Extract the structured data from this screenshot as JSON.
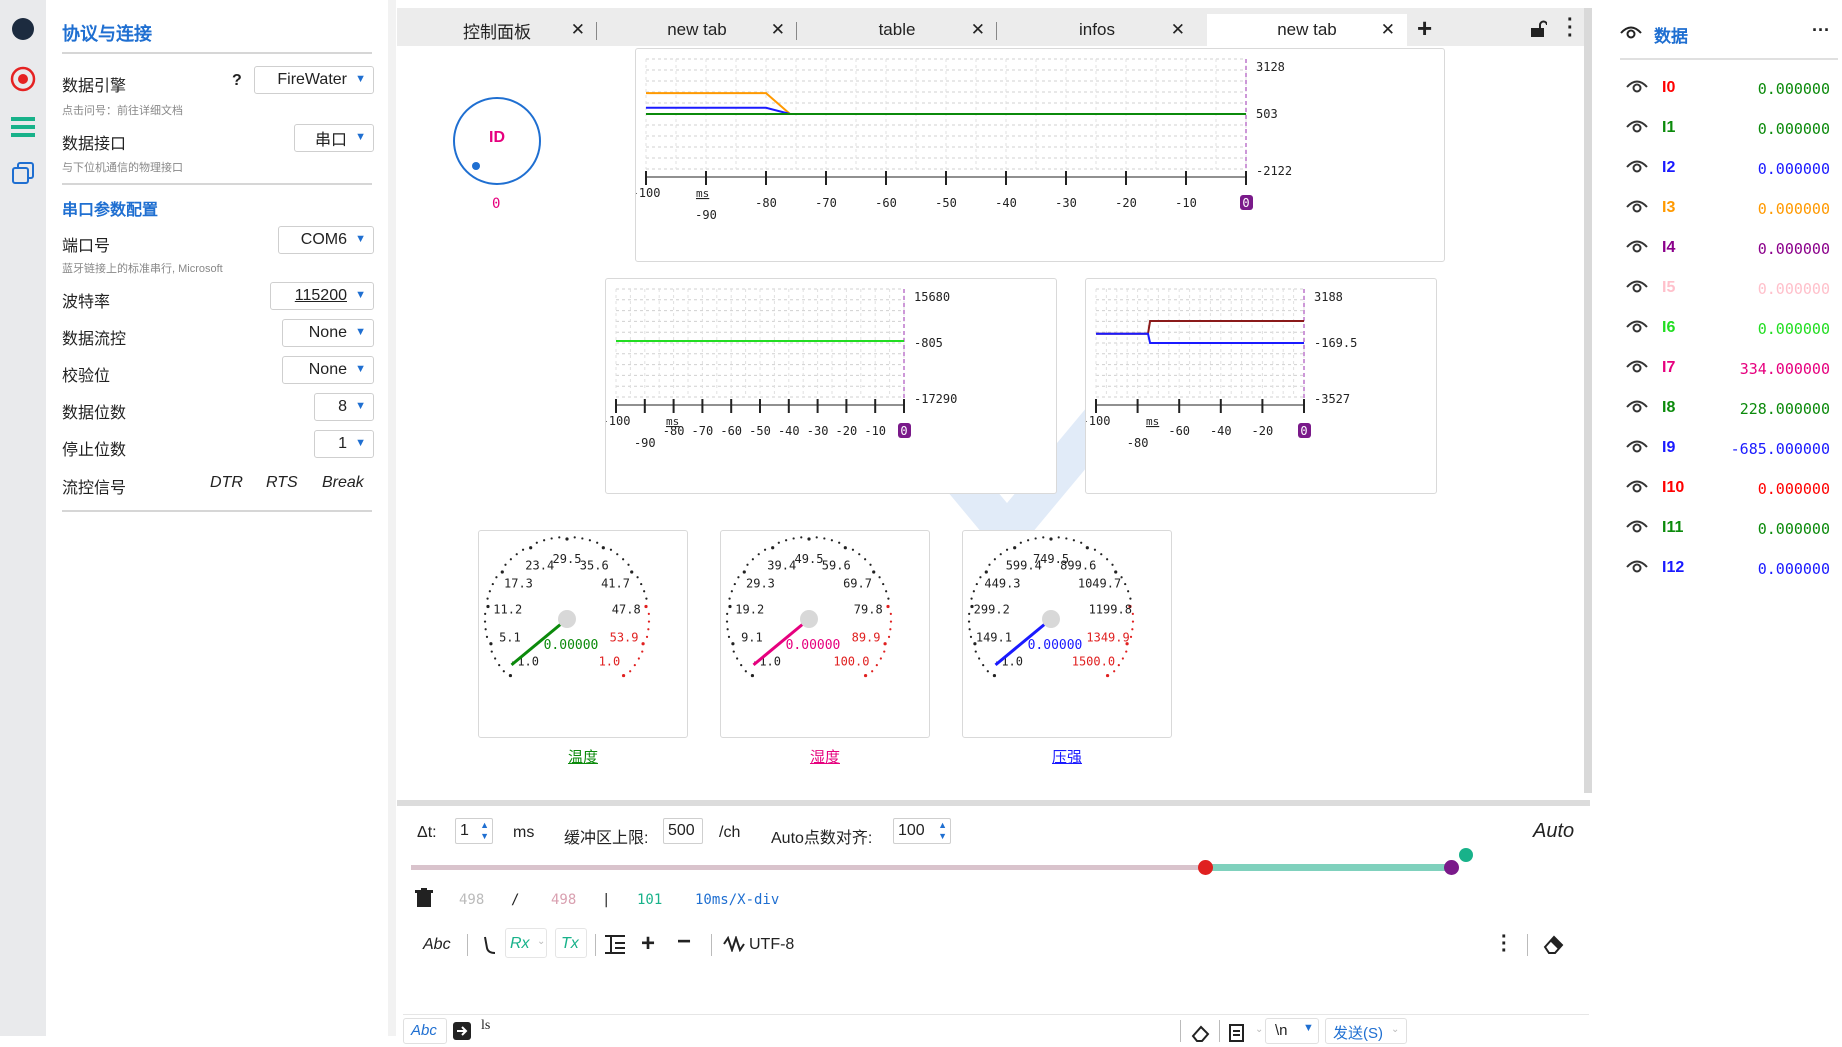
{
  "sidebar": {
    "icons": [
      "record-circle-icon",
      "target-icon",
      "list-icon",
      "copy-icon"
    ]
  },
  "left": {
    "section1_title": "协议与连接",
    "engine_label": "数据引擎",
    "engine_help": "?",
    "engine_value": "FireWater",
    "engine_sub": "点击问号：前往详细文档",
    "interface_label": "数据接口",
    "interface_value": "串口",
    "interface_sub": "与下位机通信的物理接口",
    "section2_title": "串口参数配置",
    "port_label": "端口号",
    "port_value": "COM6",
    "port_sub": "蓝牙链接上的标准串行, Microsoft",
    "baud_label": "波特率",
    "baud_value": "115200",
    "flow_label": "数据流控",
    "flow_value": "None",
    "parity_label": "校验位",
    "parity_value": "None",
    "databits_label": "数据位数",
    "databits_value": "8",
    "stopbits_label": "停止位数",
    "stopbits_value": "1",
    "signal_label": "流控信号",
    "signal_dtr": "DTR",
    "signal_rts": "RTS",
    "signal_break": "Break"
  },
  "tabs": [
    {
      "label": "控制面板"
    },
    {
      "label": "new tab"
    },
    {
      "label": "table"
    },
    {
      "label": "infos"
    },
    {
      "label": "new tab"
    }
  ],
  "tab_add": "+",
  "id_widget": {
    "label": "ID",
    "value": "0"
  },
  "charts": {
    "top": {
      "y_ticks": [
        "3128",
        "503",
        "-2122"
      ],
      "x_ticks": [
        "-100",
        "-90",
        "-80",
        "-70",
        "-60",
        "-50",
        "-40",
        "-30",
        "-20",
        "-10",
        "0"
      ],
      "unit": "ms"
    },
    "mid_left": {
      "y_ticks": [
        "15680",
        "-805",
        "-17290"
      ],
      "x_ticks": [
        "-100",
        "-90",
        "-80",
        "-70",
        "-60",
        "-50",
        "-40",
        "-30",
        "-20",
        "-10",
        "0"
      ],
      "unit": "ms"
    },
    "mid_right": {
      "y_ticks": [
        "3188",
        "-169.5",
        "-3527"
      ],
      "x_ticks": [
        "-100",
        "-80",
        "-60",
        "-40",
        "-20",
        "0"
      ],
      "unit": "ms"
    }
  },
  "chart_data": [
    {
      "type": "line",
      "x": [
        -100,
        -80,
        -76,
        0
      ],
      "series": [
        {
          "values": [
            1500,
            1500,
            503,
            503
          ],
          "color": "#ff9900"
        },
        {
          "values": [
            800,
            800,
            503,
            503
          ],
          "color": "#1a1aff"
        },
        {
          "values": [
            503,
            503,
            503,
            503
          ],
          "color": "#0b8a0b"
        }
      ],
      "ylim": [
        -2122,
        3128
      ],
      "xlim": [
        -100,
        0
      ]
    },
    {
      "type": "line",
      "x": [
        -100,
        -90,
        0
      ],
      "series": [
        {
          "values": [
            -200,
            -200,
            -200
          ],
          "color": "#22dd22"
        }
      ],
      "ylim": [
        -17290,
        15680
      ],
      "xlim": [
        -100,
        0
      ]
    },
    {
      "type": "line",
      "x": [
        -100,
        -75,
        -74,
        0
      ],
      "series": [
        {
          "values": [
            400,
            400,
            1200,
            1200
          ],
          "color": "#8b1a1a"
        },
        {
          "values": [
            400,
            400,
            -169.5,
            -169.5
          ],
          "color": "#1a1aff"
        }
      ],
      "ylim": [
        -3527,
        3188
      ],
      "xlim": [
        -100,
        0
      ]
    }
  ],
  "gauges": [
    {
      "name": "温度",
      "value": "0.00000",
      "color": "#0b8a0b",
      "ticks": [
        "-1.0",
        "5.1",
        "11.2",
        "17.3",
        "23.4",
        "29.5",
        "35.6",
        "41.7",
        "47.8",
        "53.9",
        "1.0"
      ]
    },
    {
      "name": "湿度",
      "value": "0.00000",
      "color": "#e6007e",
      "ticks": [
        "-1.0",
        "9.1",
        "19.2",
        "29.3",
        "39.4",
        "49.5",
        "59.6",
        "69.7",
        "79.8",
        "89.9",
        "100.0"
      ]
    },
    {
      "name": "压强",
      "value": "0.00000",
      "color": "#1a1aff",
      "ticks": [
        "-1.0",
        "149.1",
        "299.2",
        "449.3",
        "599.4",
        "749.5",
        "899.6",
        "1049.7",
        "1199.8",
        "1349.9",
        "1500.0"
      ]
    }
  ],
  "controls": {
    "dt_label": "Δt:",
    "dt_value": "1",
    "dt_unit": "ms",
    "buf_label": "缓冲区上限:",
    "buf_value": "500",
    "buf_unit": "/ch",
    "align_label": "Auto点数对齐:",
    "align_value": "100",
    "auto": "Auto"
  },
  "status": {
    "a": "498",
    "sep1": "/",
    "b": "498",
    "sep2": "|",
    "c": "101",
    "div": "10ms/X-div"
  },
  "toolbar": {
    "abc": "Abc",
    "rx": "Rx",
    "tx": "Tx",
    "encoding": "UTF-8"
  },
  "send": {
    "abc": "Abc",
    "input": "ls",
    "newline": "\\n",
    "send": "发送(S)"
  },
  "right": {
    "title": "数据",
    "more": "···",
    "channels": [
      {
        "name": "I0",
        "value": "0.000000",
        "color": "#0b8a0b",
        "name_color": "#ff0000"
      },
      {
        "name": "I1",
        "value": "0.000000",
        "color": "#0b8a0b",
        "name_color": "#0b8a0b"
      },
      {
        "name": "I2",
        "value": "0.000000",
        "color": "#1a1aff",
        "name_color": "#1a1aff"
      },
      {
        "name": "I3",
        "value": "0.000000",
        "color": "#ff9900",
        "name_color": "#ff9900"
      },
      {
        "name": "I4",
        "value": "0.000000",
        "color": "#8b008b",
        "name_color": "#8b008b"
      },
      {
        "name": "I5",
        "value": "0.000000",
        "color": "#ffc0cb",
        "name_color": "#ffc0cb"
      },
      {
        "name": "I6",
        "value": "0.000000",
        "color": "#22dd22",
        "name_color": "#22dd22"
      },
      {
        "name": "I7",
        "value": "334.000000",
        "color": "#e6007e",
        "name_color": "#e6007e"
      },
      {
        "name": "I8",
        "value": "228.000000",
        "color": "#0b8a0b",
        "name_color": "#0b8a0b"
      },
      {
        "name": "I9",
        "value": "-685.000000",
        "color": "#1a1aff",
        "name_color": "#1a1aff"
      },
      {
        "name": "I10",
        "value": "0.000000",
        "color": "#ff0000",
        "name_color": "#ff0000"
      },
      {
        "name": "I11",
        "value": "0.000000",
        "color": "#0b8a0b",
        "name_color": "#0b8a0b"
      },
      {
        "name": "I12",
        "value": "0.000000",
        "color": "#1a1aff",
        "name_color": "#1a1aff"
      }
    ]
  }
}
